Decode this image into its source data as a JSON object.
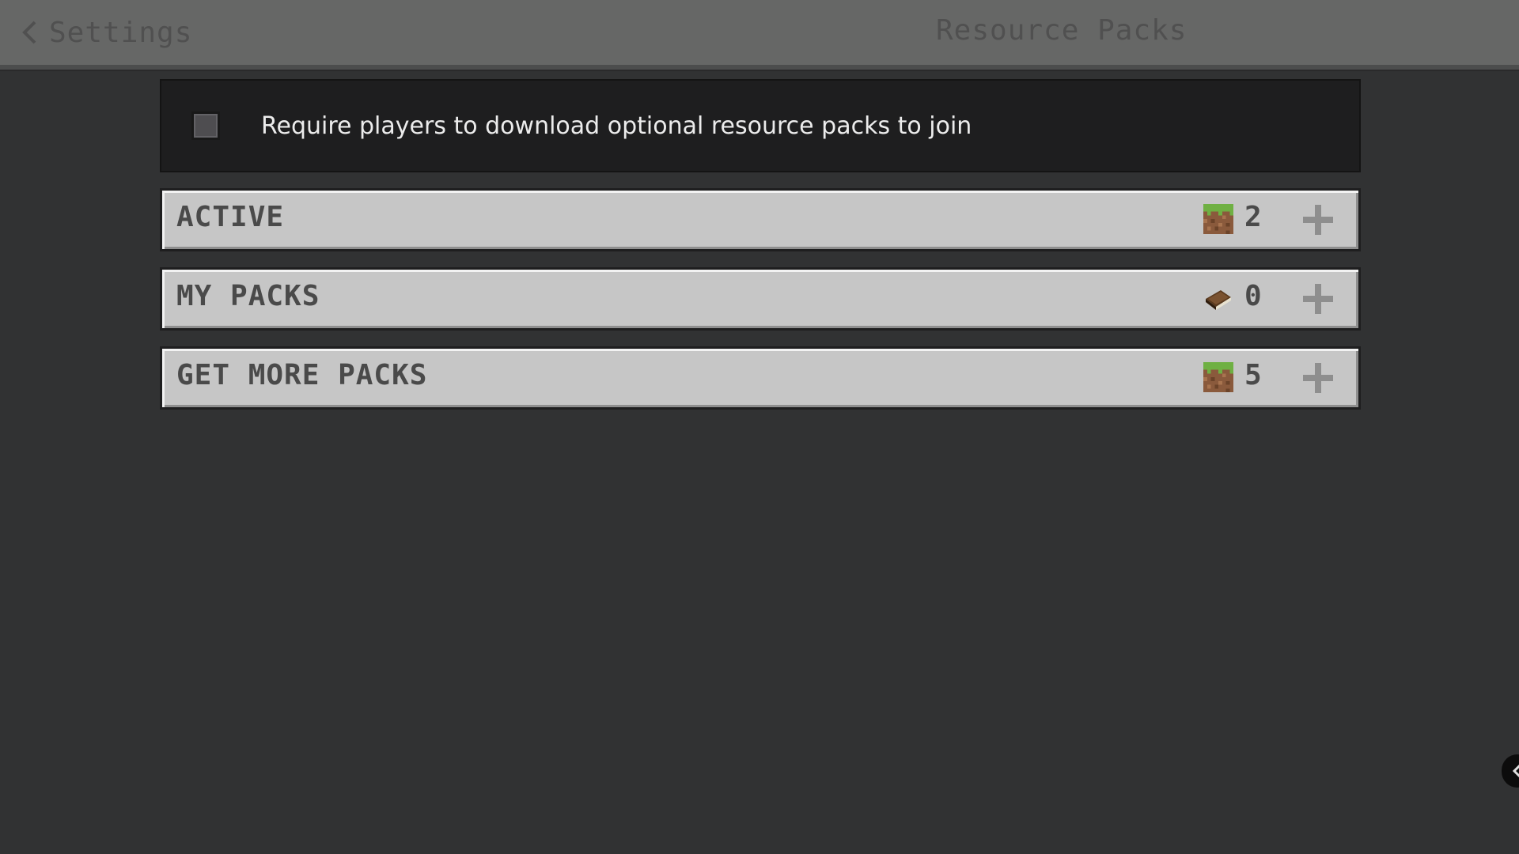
{
  "header": {
    "back_label": "Settings",
    "back_icon": "chevron-left-icon",
    "title": "Resource Packs"
  },
  "require_option": {
    "label": "Require players to download optional resource packs to join",
    "checked": false
  },
  "sections": [
    {
      "label": "ACTIVE",
      "icon": "grass-block-icon",
      "count": "2",
      "action_icon": "plus-icon"
    },
    {
      "label": "MY PACKS",
      "icon": "book-icon",
      "count": "0",
      "action_icon": "plus-icon"
    },
    {
      "label": "GET MORE PACKS",
      "icon": "grass-block-icon",
      "count": "5",
      "action_icon": "plus-icon"
    }
  ],
  "side_handle": {
    "icon": "chevron-left-icon"
  },
  "colors": {
    "background": "#313233",
    "topbar": "#666766",
    "section_fill": "#c6c6c6",
    "panel_dark": "#1e1e1f",
    "text_light": "#ececec",
    "text_dark": "#4a4a4a"
  }
}
